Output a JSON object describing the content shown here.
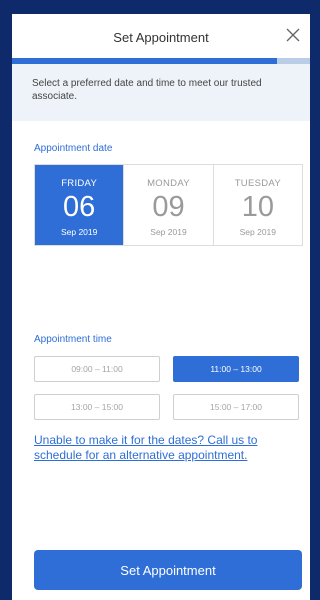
{
  "header": {
    "title": "Set Appointment",
    "close_icon": "close-icon"
  },
  "progress": {
    "fraction": 0.89
  },
  "intro": {
    "text": "Select a preferred date and time to meet our trusted associate."
  },
  "date_section": {
    "label": "Appointment date",
    "dates": [
      {
        "dow": "FRIDAY",
        "day": "06",
        "month": "Sep 2019",
        "selected": true
      },
      {
        "dow": "MONDAY",
        "day": "09",
        "month": "Sep 2019",
        "selected": false
      },
      {
        "dow": "TUESDAY",
        "day": "10",
        "month": "Sep 2019",
        "selected": false
      }
    ]
  },
  "time_section": {
    "label": "Appointment time",
    "slots": [
      {
        "label": "09:00 – 11:00",
        "selected": false
      },
      {
        "label": "11:00 – 13:00",
        "selected": true
      },
      {
        "label": "13:00 – 15:00",
        "selected": false
      },
      {
        "label": "15:00 – 17:00",
        "selected": false
      }
    ]
  },
  "alt_link": "Unable to make it for the dates? Call us to schedule for an alternative appointment.",
  "cta": {
    "label": "Set Appointment"
  },
  "colors": {
    "accent": "#2f6ed6",
    "background": "#0e2a6b",
    "intro_bg": "#eef3f9"
  }
}
